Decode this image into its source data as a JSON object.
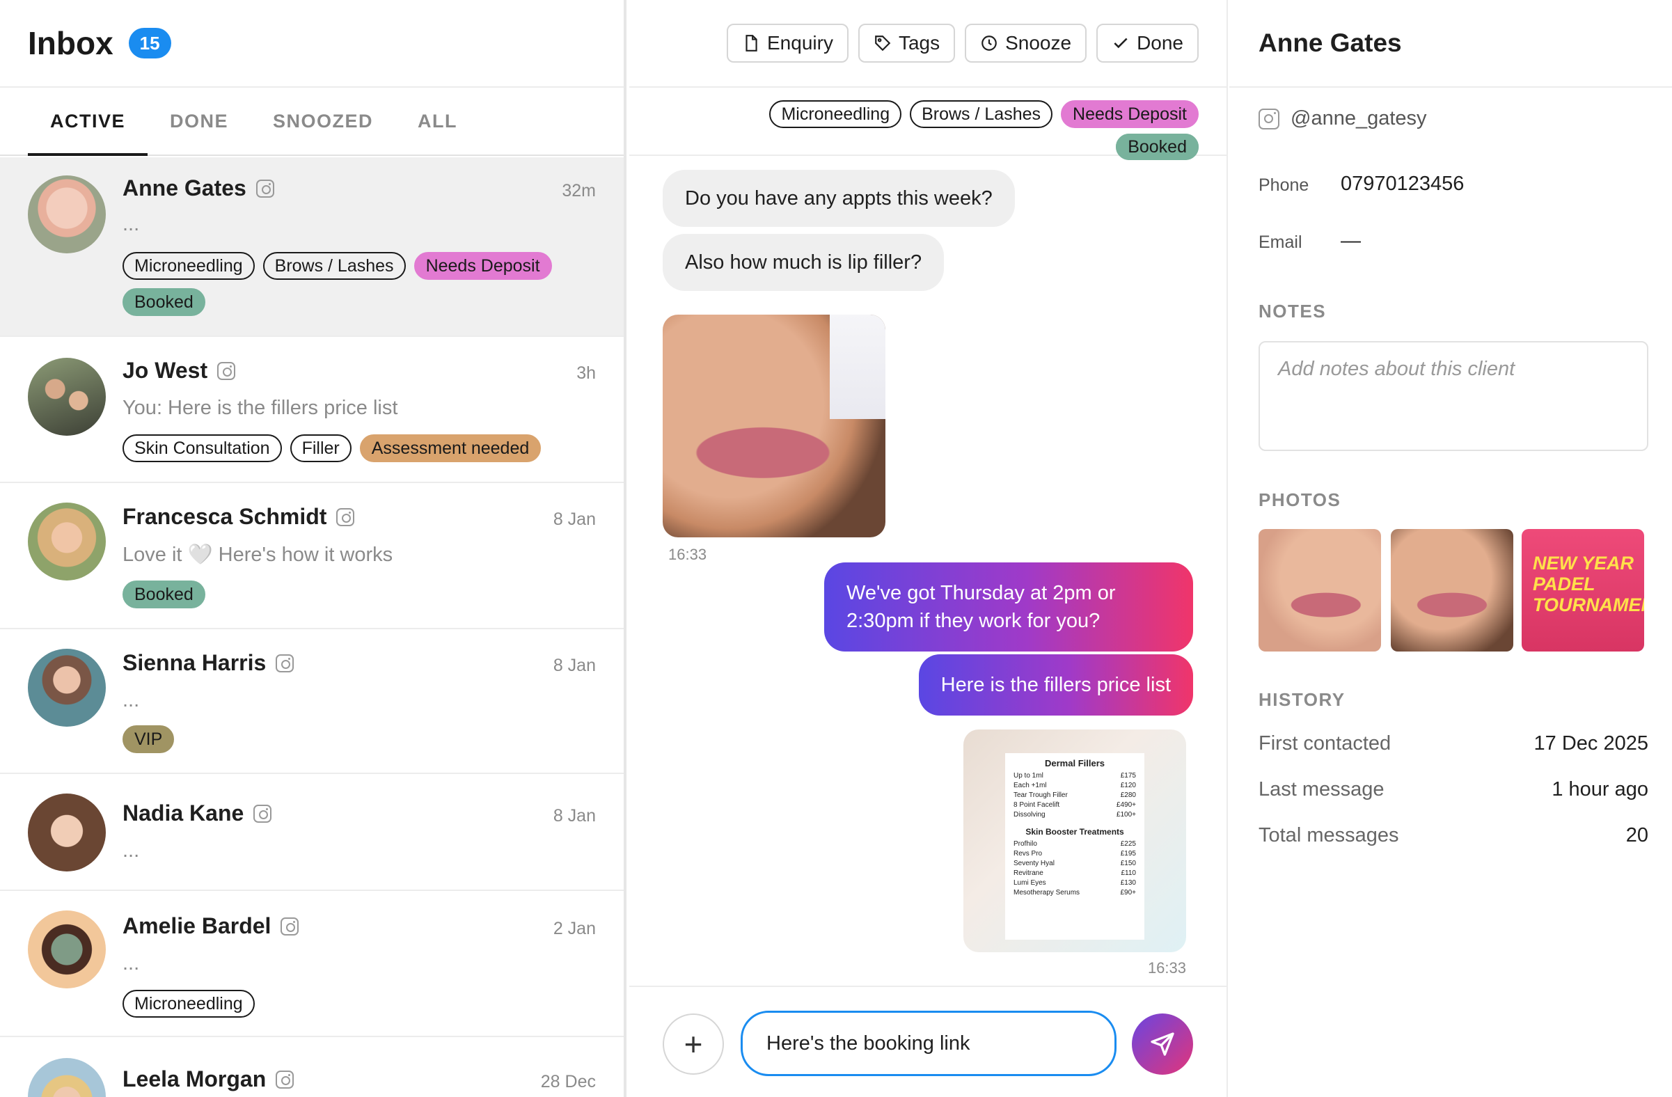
{
  "inbox": {
    "title": "Inbox",
    "count": "15"
  },
  "tabs": [
    "ACTIVE",
    "DONE",
    "SNOOZED",
    "ALL"
  ],
  "conversations": [
    {
      "name": "Anne Gates",
      "time": "32m",
      "preview": "...",
      "tags": [
        "Microneedling",
        "Brows / Lashes",
        "Needs Deposit"
      ],
      "tags2": [
        "Booked"
      ]
    },
    {
      "name": "Jo West",
      "time": "3h",
      "preview": "You: Here is the fillers price list",
      "tags": [
        "Skin Consultation",
        "Filler",
        "Assessment needed"
      ]
    },
    {
      "name": "Francesca Schmidt",
      "time": "8 Jan",
      "preview": "Love it 🤍 Here's how it works",
      "tags": [
        "Booked"
      ]
    },
    {
      "name": "Sienna Harris",
      "time": "8 Jan",
      "preview": "...",
      "tags": [
        "VIP"
      ]
    },
    {
      "name": "Nadia Kane",
      "time": "8 Jan",
      "preview": "..."
    },
    {
      "name": "Amelie Bardel",
      "time": "2 Jan",
      "preview": "...",
      "tags": [
        "Microneedling"
      ]
    },
    {
      "name": "Leela Morgan",
      "time": "28 Dec"
    }
  ],
  "toolbar": {
    "enquiry": "Enquiry",
    "tags": "Tags",
    "snooze": "Snooze",
    "done": "Done"
  },
  "chat_tags": [
    "Microneedling",
    "Brows / Lashes",
    "Needs Deposit",
    "Booked"
  ],
  "messages": {
    "in1": "Do you have any appts this week?",
    "in2": "Also how much is lip filler?",
    "time1": "16:33",
    "out1": "We've got Thursday at 2pm or 2:30pm if they work for you?",
    "out2": "Here is the fillers price list",
    "time2": "16:33"
  },
  "price_list": {
    "title1": "Dermal Fillers",
    "items1": [
      [
        "Up to 1ml",
        "£175"
      ],
      [
        "Each +1ml",
        "£120"
      ],
      [
        "Tear Trough Filler",
        "£280"
      ],
      [
        "8 Point Facelift",
        "£490+"
      ],
      [
        "Dissolving",
        "£100+"
      ]
    ],
    "title2": "Skin Booster Treatments",
    "items2": [
      [
        "Profhilo",
        "£225"
      ],
      [
        "Revs Pro",
        "£195"
      ],
      [
        "Seventy Hyal",
        "£150"
      ],
      [
        "Revitrane",
        "£110"
      ],
      [
        "Lumi Eyes",
        "£130"
      ],
      [
        "Mesotherapy Serums",
        "£90+"
      ]
    ]
  },
  "composer": {
    "value": "Here's the booking link"
  },
  "client": {
    "name": "Anne Gates",
    "handle": "@anne_gatesy",
    "phone_label": "Phone",
    "phone": "07970123456",
    "email_label": "Email",
    "email": "—",
    "notes_label": "NOTES",
    "notes_placeholder": "Add notes about this client",
    "photos_label": "PHOTOS",
    "poster_title": "NEW YEAR PADEL TOURNAMENT",
    "history_label": "HISTORY",
    "first_label": "First contacted",
    "first": "17 Dec 2025",
    "last_label": "Last message",
    "last": "1 hour ago",
    "total_label": "Total messages",
    "total": "20"
  },
  "colors": {
    "accent": "#1a8cf0",
    "pink_tag": "#e27ad2",
    "green_tag": "#78b29c",
    "orange_tag": "#d9a36d",
    "olive_tag": "#a09463"
  }
}
